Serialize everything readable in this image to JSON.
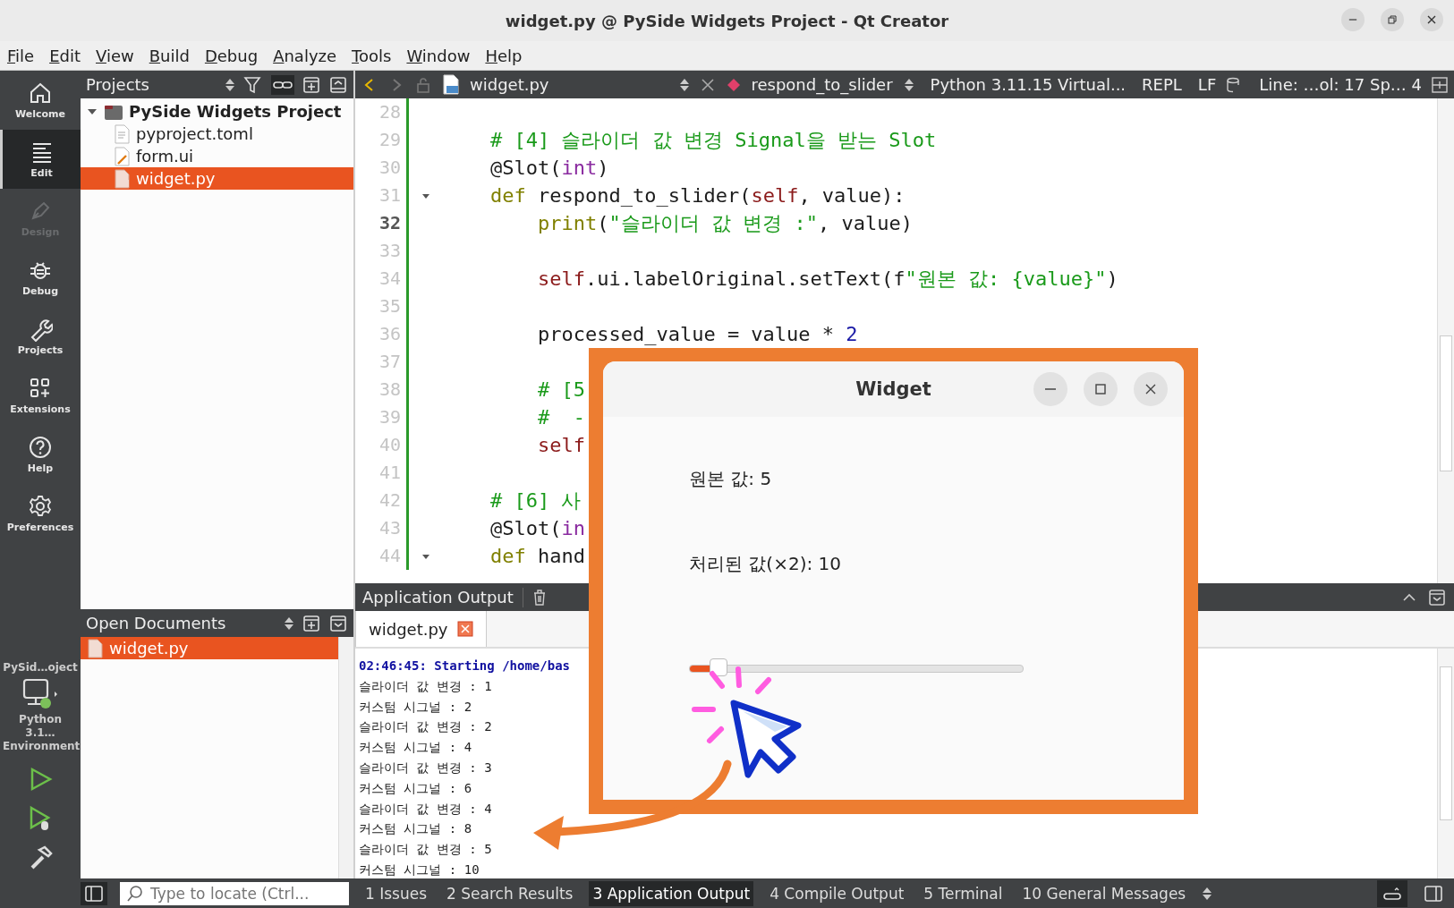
{
  "window": {
    "title": "widget.py @ PySide Widgets Project - Qt Creator"
  },
  "menu": [
    "File",
    "Edit",
    "View",
    "Build",
    "Debug",
    "Analyze",
    "Tools",
    "Window",
    "Help"
  ],
  "modes": [
    {
      "label": "Welcome",
      "selected": false,
      "disabled": false
    },
    {
      "label": "Edit",
      "selected": true,
      "disabled": false
    },
    {
      "label": "Design",
      "selected": false,
      "disabled": true
    },
    {
      "label": "Debug",
      "selected": false,
      "disabled": false
    },
    {
      "label": "Projects",
      "selected": false,
      "disabled": false
    },
    {
      "label": "Extensions",
      "selected": false,
      "disabled": false
    },
    {
      "label": "Help",
      "selected": false,
      "disabled": false
    },
    {
      "label": "Preferences",
      "selected": false,
      "disabled": false
    }
  ],
  "kit": {
    "project": "PySid…oject",
    "target": "Python 3.1… Environment"
  },
  "projects": {
    "title": "Projects",
    "tree": [
      {
        "label": "PySide Widgets Project",
        "kind": "project",
        "expanded": true,
        "selected": false,
        "children": [
          {
            "label": "pyproject.toml",
            "kind": "text",
            "selected": false
          },
          {
            "label": "form.ui",
            "kind": "form",
            "selected": false
          },
          {
            "label": "widget.py",
            "kind": "python",
            "selected": true
          }
        ]
      }
    ]
  },
  "open_documents": {
    "title": "Open Documents",
    "items": [
      {
        "label": "widget.py",
        "selected": true
      }
    ]
  },
  "editor": {
    "file": "widget.py",
    "symbol": "respond_to_slider",
    "interpreter": "Python 3.11.15 Virtual...",
    "repl": "REPL",
    "line_ending": "LF",
    "position": "Line: …ol: 17 Sp… 4",
    "lines": [
      {
        "number": "28",
        "current": false,
        "foldable": false
      },
      {
        "number": "29",
        "current": false,
        "foldable": false,
        "tokens": [
          {
            "kind": "comment",
            "text": "    # [4] 슬라이더 값 변경 Signal을 받는 Slot"
          }
        ]
      },
      {
        "number": "30",
        "current": false,
        "foldable": false,
        "tokens": [
          {
            "kind": "plain",
            "text": "    @Slot("
          },
          {
            "kind": "type",
            "text": "int"
          },
          {
            "kind": "plain",
            "text": ")"
          }
        ]
      },
      {
        "number": "31",
        "current": false,
        "foldable": true,
        "tokens": [
          {
            "kind": "keyword",
            "text": "    def"
          },
          {
            "kind": "plain",
            "text": " respond_to_slider("
          },
          {
            "kind": "self",
            "text": "self"
          },
          {
            "kind": "plain",
            "text": ", value):"
          }
        ]
      },
      {
        "number": "32",
        "current": true,
        "foldable": false,
        "tokens": [
          {
            "kind": "keyword",
            "text": "        print"
          },
          {
            "kind": "plain",
            "text": "("
          },
          {
            "kind": "string",
            "text": "\"슬라이더 값 변경 :\""
          },
          {
            "kind": "plain",
            "text": ", value)"
          }
        ]
      },
      {
        "number": "33",
        "current": false,
        "foldable": false
      },
      {
        "number": "34",
        "current": false,
        "foldable": false,
        "tokens": [
          {
            "kind": "self",
            "text": "        self"
          },
          {
            "kind": "plain",
            "text": ".ui.labelOriginal.setText(f"
          },
          {
            "kind": "string",
            "text": "\"원본 값: {value}\""
          },
          {
            "kind": "plain",
            "text": ")"
          }
        ]
      },
      {
        "number": "35",
        "current": false,
        "foldable": false
      },
      {
        "number": "36",
        "current": false,
        "foldable": false,
        "tokens": [
          {
            "kind": "plain",
            "text": "        processed_value = value * "
          },
          {
            "kind": "number",
            "text": "2"
          }
        ]
      },
      {
        "number": "37",
        "current": false,
        "foldable": false
      },
      {
        "number": "38",
        "current": false,
        "foldable": false,
        "tokens": [
          {
            "kind": "comment",
            "text": "        # [5"
          }
        ]
      },
      {
        "number": "39",
        "current": false,
        "foldable": false,
        "tokens": [
          {
            "kind": "comment",
            "text": "        #  -"
          }
        ]
      },
      {
        "number": "40",
        "current": false,
        "foldable": false,
        "tokens": [
          {
            "kind": "self",
            "text": "        self"
          }
        ]
      },
      {
        "number": "41",
        "current": false,
        "foldable": false
      },
      {
        "number": "42",
        "current": false,
        "foldable": false,
        "tokens": [
          {
            "kind": "comment",
            "text": "    # [6] 사"
          }
        ]
      },
      {
        "number": "43",
        "current": false,
        "foldable": false,
        "tokens": [
          {
            "kind": "plain",
            "text": "    @Slot("
          },
          {
            "kind": "type",
            "text": "in"
          }
        ]
      },
      {
        "number": "44",
        "current": false,
        "foldable": true,
        "tokens": [
          {
            "kind": "keyword",
            "text": "    def"
          },
          {
            "kind": "plain",
            "text": " hand"
          }
        ]
      }
    ]
  },
  "output": {
    "title": "Application Output",
    "tabs": [
      {
        "label": "widget.py",
        "selected": true
      }
    ],
    "lines": [
      {
        "kind": "info",
        "text": "02:46:45: Starting /home/bas"
      },
      {
        "kind": "plain",
        "text": "슬라이더 값 변경 : 1"
      },
      {
        "kind": "plain",
        "text": "커스텀 시그널 : 2"
      },
      {
        "kind": "plain",
        "text": "슬라이더 값 변경 : 2"
      },
      {
        "kind": "plain",
        "text": "커스텀 시그널 : 4"
      },
      {
        "kind": "plain",
        "text": "슬라이더 값 변경 : 3"
      },
      {
        "kind": "plain",
        "text": "커스텀 시그널 : 6"
      },
      {
        "kind": "plain",
        "text": "슬라이더 값 변경 : 4"
      },
      {
        "kind": "plain",
        "text": "커스텀 시그널 : 8"
      },
      {
        "kind": "plain",
        "text": "슬라이더 값 변경 : 5"
      },
      {
        "kind": "plain",
        "text": "커스텀 시그널 : 10"
      }
    ]
  },
  "status_bar": {
    "locate_placeholder": "Type to locate (Ctrl...",
    "tabs": [
      {
        "label": "1  Issues",
        "selected": false
      },
      {
        "label": "2  Search Results",
        "selected": false
      },
      {
        "label": "3  Application Output",
        "selected": true
      },
      {
        "label": "4  Compile Output",
        "selected": false
      },
      {
        "label": "5  Terminal",
        "selected": false
      },
      {
        "label": "10  General Messages",
        "selected": false
      }
    ]
  },
  "widget_window": {
    "title": "Widget",
    "original": "원본 값: 5",
    "processed": "처리된 값(×2): 10",
    "slider": {
      "level": 0.075
    }
  }
}
